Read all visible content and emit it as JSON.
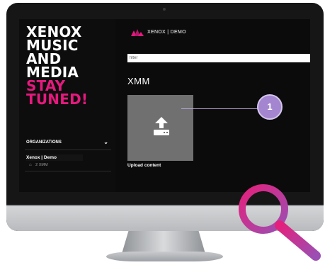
{
  "sidebar": {
    "hero_lines": [
      "XENOX",
      "MUSIC",
      "AND",
      "MEDIA",
      "STAY",
      "TUNED!"
    ],
    "organizations_label": "ORGANIZATIONS",
    "org_name": "Xenox | Demo",
    "sub_item": "2 XMM"
  },
  "topbar": {
    "brand": "XENOX | DEMO"
  },
  "filter": {
    "placeholder": "filter"
  },
  "main": {
    "section_title": "XMM",
    "upload_label": "Upload content",
    "callout_number": "1"
  },
  "colors": {
    "accent_pink": "#e5197d",
    "callout_purple": "#a386cf",
    "tile_gray": "#6f706f",
    "magnifier_gradient": [
      "#e4207c",
      "#9b4fb3"
    ]
  },
  "icons": [
    "logo-icon",
    "chevron-down-icon",
    "home-icon",
    "upload-icon",
    "magnifier-icon"
  ]
}
